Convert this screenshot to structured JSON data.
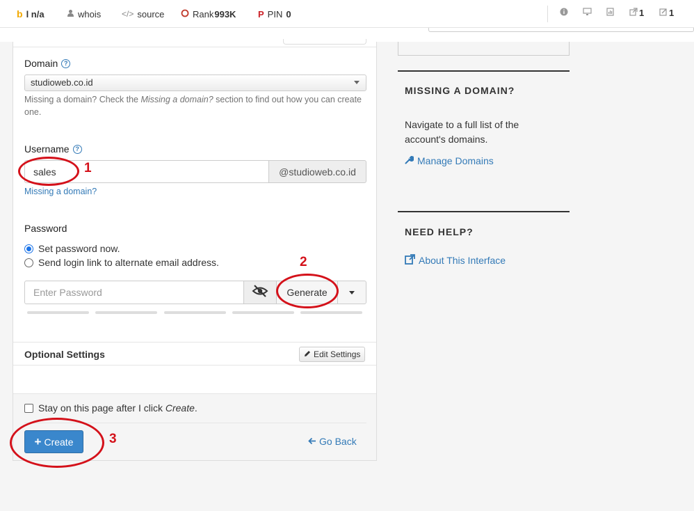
{
  "topbar": {
    "items": [
      {
        "label": "l n/a"
      },
      {
        "label": "whois"
      },
      {
        "label": "source"
      },
      {
        "label": "Rank",
        "value": "993K"
      },
      {
        "label": "PIN",
        "value": "0"
      }
    ],
    "right": [
      {
        "icon": "info-icon"
      },
      {
        "icon": "monitor-icon"
      },
      {
        "icon": "page-icon"
      },
      {
        "icon": "external-links-icon",
        "value": "1"
      },
      {
        "icon": "edit-links-icon",
        "value": "1"
      }
    ]
  },
  "form": {
    "domain_label": "Domain",
    "domain_value": "studioweb.co.id",
    "domain_hint_1": "Missing a domain? Check the ",
    "domain_hint_em": "Missing a domain?",
    "domain_hint_2": " section to find out how you can create one.",
    "username_label": "Username",
    "username_value": "sales",
    "username_suffix": "@studioweb.co.id",
    "username_missing_link": "Missing a domain?",
    "password_label": "Password",
    "radio_set_now": "Set password now.",
    "radio_send_link": "Send login link to alternate email address.",
    "password_placeholder": "Enter Password",
    "generate_label": "Generate",
    "optional_title": "Optional Settings",
    "edit_settings_label": "Edit Settings",
    "stay_text": "Stay on this page after I click ",
    "stay_em": "Create",
    "stay_end": ".",
    "create_label": "Create",
    "goback_label": "Go Back"
  },
  "annotations": {
    "n1": "1",
    "n2": "2",
    "n3": "3",
    "color": "#d4111a"
  },
  "sidebar": {
    "missing_title": "MISSING A DOMAIN?",
    "missing_text": "Navigate to a full list of the account's domains.",
    "manage_link": "Manage Domains",
    "help_title": "NEED HELP?",
    "about_link": "About This Interface"
  },
  "colors": {
    "primary_button": "#3a87cc",
    "link": "#337ab7"
  }
}
